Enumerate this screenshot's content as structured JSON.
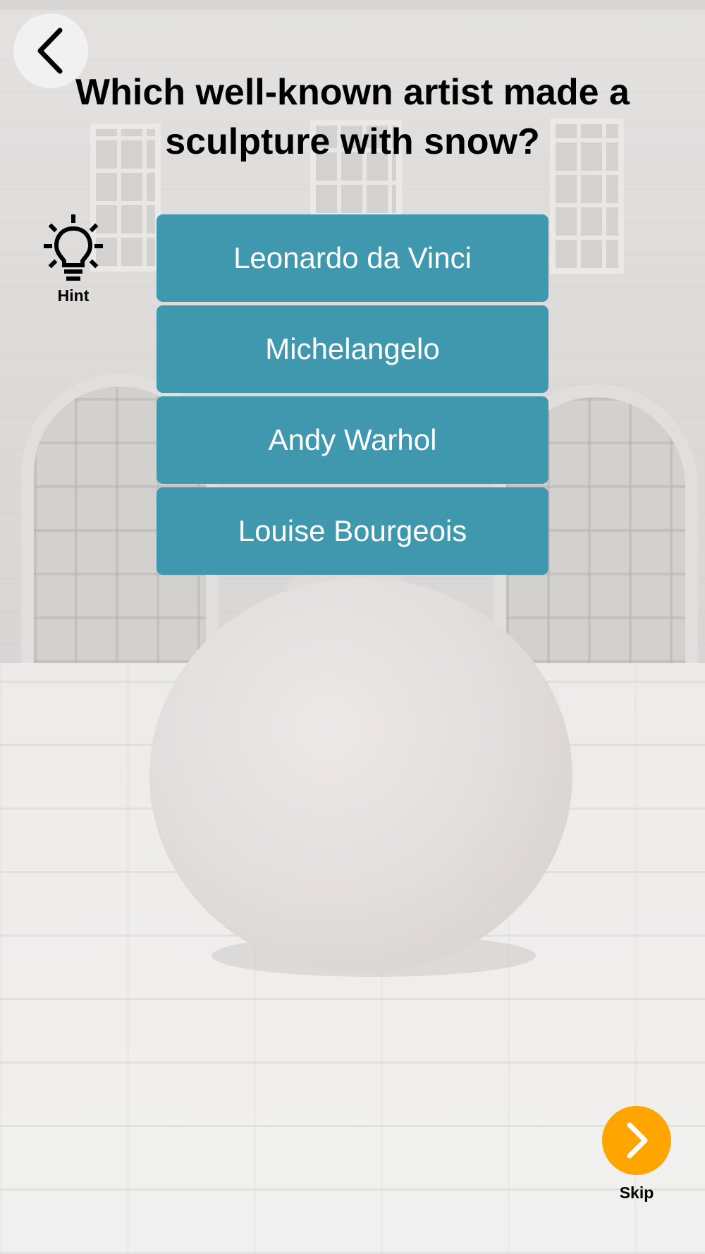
{
  "quiz": {
    "question": "Which well-known artist made a sculpture with snow?",
    "answers": [
      {
        "label": "Leonardo da Vinci"
      },
      {
        "label": "Michelangelo"
      },
      {
        "label": "Andy Warhol"
      },
      {
        "label": "Louise Bourgeois"
      }
    ]
  },
  "controls": {
    "back_icon": "chevron-left-icon",
    "hint_icon": "lightbulb-icon",
    "hint_label": "Hint",
    "skip_icon": "chevron-right-icon",
    "skip_label": "Skip"
  },
  "colors": {
    "answer_button": "#3f98ae",
    "skip_button": "#ffa500",
    "text_primary": "#000000"
  }
}
